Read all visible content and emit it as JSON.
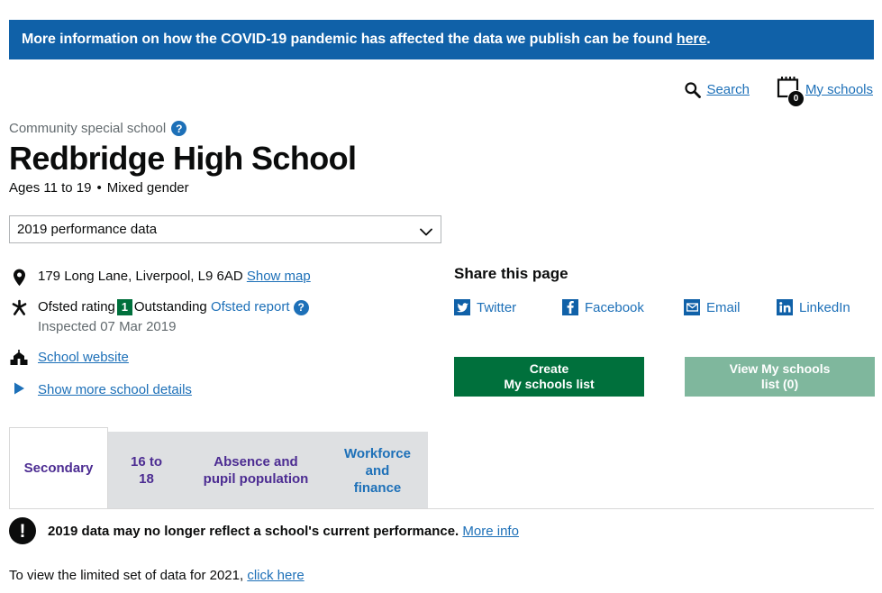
{
  "banner": {
    "text_before": "More information on how the COVID-19 pandemic has affected the data we publish can be found ",
    "link_label": "here",
    "text_after": ".",
    "bg_color": "#1061a8"
  },
  "utility_nav": {
    "search_label": "Search",
    "my_schools_label": "My schools",
    "my_schools_count": "0",
    "search_icon": "search-icon",
    "notepad_icon": "notepad-icon"
  },
  "school": {
    "type": "Community special school",
    "type_help_icon": "question-mark-icon",
    "name": "Redbridge High School",
    "ages": "Ages 11 to 19",
    "separator": "•",
    "gender": "Mixed gender"
  },
  "year_select": {
    "selected": "2019 performance data",
    "options": [
      "2019 performance data"
    ],
    "chevron_icon": "chevron-down-icon"
  },
  "details": {
    "address": {
      "icon": "map-pin-icon",
      "text": "179 Long Lane, Liverpool, L9 6AD",
      "link_label": "Show map"
    },
    "ofsted": {
      "icon": "ofsted-star-icon",
      "label": "Ofsted rating",
      "badge": "1",
      "badge_color": "#00703c",
      "rating": "Outstanding",
      "report_link": "Ofsted report",
      "help_icon": "question-mark-icon",
      "inspected": "Inspected 07 Mar 2019"
    },
    "website": {
      "icon": "school-building-icon",
      "link_label": "School website"
    },
    "more_details": {
      "icon": "triangle-right-icon",
      "link_label": "Show more school details"
    }
  },
  "share": {
    "title": "Share this page",
    "items": [
      {
        "label": "Twitter",
        "icon": "twitter-icon"
      },
      {
        "label": "Facebook",
        "icon": "facebook-icon"
      },
      {
        "label": "Email",
        "icon": "email-icon"
      },
      {
        "label": "LinkedIn",
        "icon": "linkedin-icon"
      }
    ]
  },
  "buttons": {
    "create": {
      "line1": "Create",
      "line2": "My schools list",
      "color": "#00703c"
    },
    "view": {
      "line1": "View My schools",
      "line2": "list (0)",
      "color": "#7fb79d"
    }
  },
  "tabs": [
    {
      "label": "Secondary",
      "active": true
    },
    {
      "label": "16 to 18",
      "active": false
    },
    {
      "label": "Absence and\npupil population",
      "line1": "Absence and",
      "line2": "pupil population",
      "active": false
    },
    {
      "label": "Workforce\nand finance",
      "line1": "Workforce",
      "line2": "and finance",
      "active": false
    }
  ],
  "notice": {
    "icon": "exclamation-icon",
    "text": "2019 data may no longer reflect a school's current performance.",
    "link_label": "More info"
  },
  "footnote": {
    "text_before": "To view the limited set of data for 2021, ",
    "link_label": "click here"
  }
}
